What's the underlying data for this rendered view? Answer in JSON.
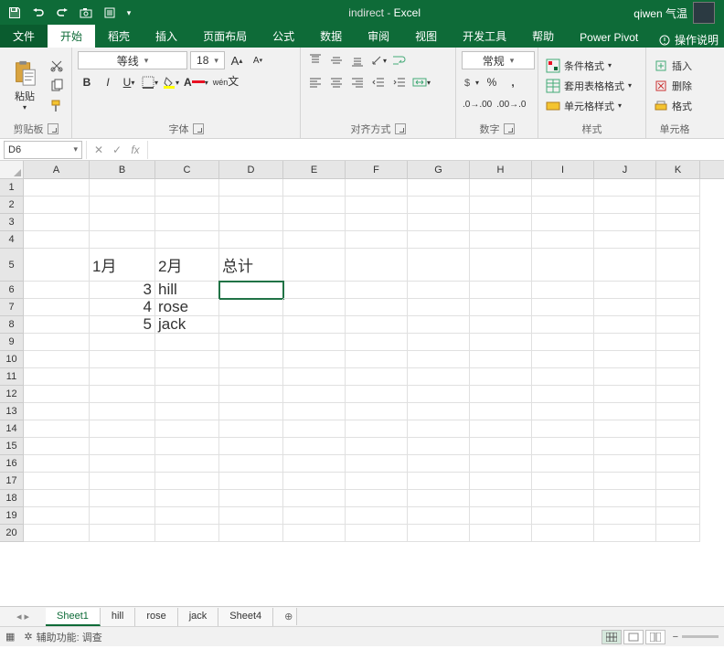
{
  "title": {
    "doc": "indirect",
    "app": "Excel",
    "user": "qiwen 气温"
  },
  "tabs": [
    "文件",
    "开始",
    "稻壳",
    "插入",
    "页面布局",
    "公式",
    "数据",
    "审阅",
    "视图",
    "开发工具",
    "帮助",
    "Power Pivot"
  ],
  "active_tab_index": 1,
  "tell_me": "操作说明",
  "ribbon": {
    "clipboard": {
      "paste": "粘贴",
      "label": "剪贴板"
    },
    "font": {
      "name": "等线",
      "size": "18",
      "label": "字体"
    },
    "align": {
      "label": "对齐方式"
    },
    "number": {
      "format": "常规",
      "label": "数字"
    },
    "styles": {
      "cond": "条件格式",
      "table": "套用表格格式",
      "cell": "单元格样式",
      "label": "样式"
    },
    "cells": {
      "insert": "插入",
      "delete": "删除",
      "format": "格式",
      "label": "单元格"
    }
  },
  "namebox": "D6",
  "formula": "",
  "columns": [
    "A",
    "B",
    "C",
    "D",
    "E",
    "F",
    "G",
    "H",
    "I",
    "J",
    "K"
  ],
  "rows": 20,
  "tall_row": 5,
  "active_cell": {
    "r": 6,
    "c": "D"
  },
  "cells": {
    "B5": "1月",
    "C5": "2月",
    "D5": "总计",
    "B6": "3",
    "C6": "hill",
    "B7": "4",
    "C7": "rose",
    "B8": "5",
    "C8": "jack"
  },
  "numeric": [
    "B6",
    "B7",
    "B8"
  ],
  "sheets": [
    "Sheet1",
    "hill",
    "rose",
    "jack",
    "Sheet4"
  ],
  "active_sheet": 0,
  "status": {
    "a11y": "辅助功能: 调查"
  }
}
